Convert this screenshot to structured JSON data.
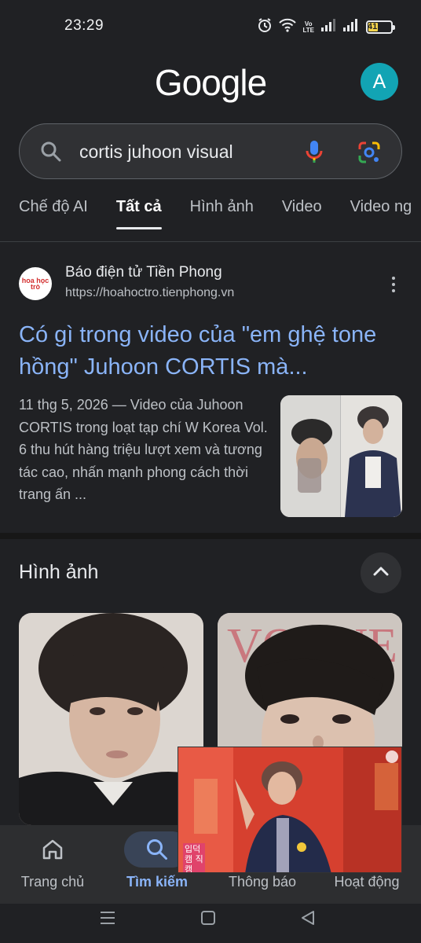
{
  "status_bar": {
    "time": "23:29",
    "volte_top": "Vo",
    "volte_mid": "LTE",
    "volte_bottom": "",
    "battery": "41"
  },
  "header": {
    "logo_text": "Google",
    "avatar_letter": "A",
    "avatar_color": "#12a4b4"
  },
  "search": {
    "query": "cortis juhoon visual"
  },
  "tabs": [
    {
      "label": "Chế độ AI",
      "active": false
    },
    {
      "label": "Tất cả",
      "active": true
    },
    {
      "label": "Hình ảnh",
      "active": false
    },
    {
      "label": "Video",
      "active": false
    },
    {
      "label": "Video ng",
      "active": false
    }
  ],
  "result": {
    "site_logo_text": "hoa học trò",
    "site_name": "Báo điện tử Tiền Phong",
    "site_url": "https://hoahoctro.tienphong.vn",
    "title": "Có gì trong video của \"em ghệ tone hồng\" Juhoon CORTIS mà...",
    "snippet": "11 thg 5, 2026 — Video của Juhoon CORTIS trong loạt tạp chí W Korea Vol. 6 thu hút hàng triệu lượt xem và tương tác cao, nhấn mạnh phong cách thời trang ấn ..."
  },
  "images_section": {
    "heading": "Hình ảnh",
    "right_card_text": "VOGUE"
  },
  "pip": {
    "caption": "입덕캠 직캠"
  },
  "bottom_nav": [
    {
      "label": "Trang chủ",
      "icon": "home-icon",
      "active": false
    },
    {
      "label": "Tìm kiếm",
      "icon": "search-icon",
      "active": true
    },
    {
      "label": "Thông báo",
      "icon": "bell-icon",
      "active": false
    },
    {
      "label": "Hoạt động",
      "icon": "history-icon",
      "active": false
    }
  ],
  "colors": {
    "background": "#202124",
    "link": "#8ab4f8",
    "accent_active": "#8ab4f8",
    "battery": "#f5d44c"
  }
}
